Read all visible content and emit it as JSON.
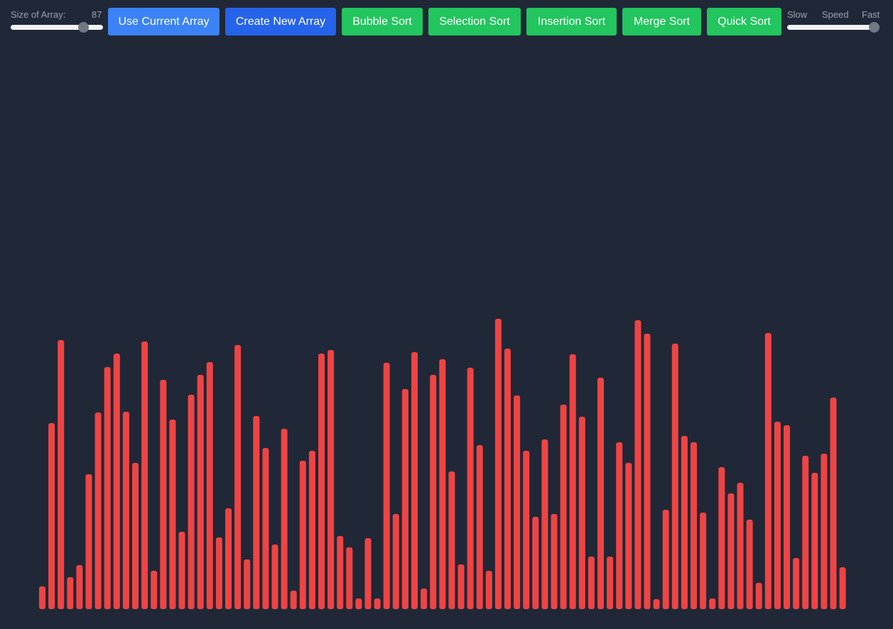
{
  "controls": {
    "size_label": "Size of Array:",
    "size_value": "87",
    "size_slider_fraction": 0.83,
    "speed_labels": [
      "Slow",
      "Speed",
      "Fast"
    ],
    "speed_slider_fraction": 1.0
  },
  "buttons": [
    {
      "id": "use-current-array",
      "label": "Use Current Array",
      "color": "#3b82f6"
    },
    {
      "id": "create-new-array",
      "label": "Create New Array",
      "color": "#2563eb"
    },
    {
      "id": "bubble-sort",
      "label": "Bubble Sort",
      "color": "#22c55e"
    },
    {
      "id": "selection-sort",
      "label": "Selection Sort",
      "color": "#22c55e"
    },
    {
      "id": "insertion-sort",
      "label": "Insertion Sort",
      "color": "#22c55e"
    },
    {
      "id": "merge-sort",
      "label": "Merge Sort",
      "color": "#22c55e"
    },
    {
      "id": "quick-sort",
      "label": "Quick Sort",
      "color": "#22c55e"
    }
  ],
  "colors": {
    "background": "#202837",
    "bar": "#ef4444"
  },
  "array_values": [
    28,
    258,
    375,
    41,
    58,
    186,
    273,
    337,
    356,
    274,
    202,
    373,
    50,
    319,
    263,
    105,
    298,
    326,
    344,
    97,
    138,
    368,
    66,
    268,
    223,
    87,
    250,
    22,
    205,
    219,
    356,
    361,
    99,
    83,
    11,
    96,
    11,
    343,
    130,
    306,
    358,
    25,
    326,
    348,
    190,
    59,
    336,
    227,
    50,
    405,
    363,
    297,
    219,
    126,
    235,
    130,
    284,
    355,
    267,
    70,
    322,
    70,
    231,
    202,
    403,
    384,
    10,
    136,
    370,
    240,
    231,
    132,
    11,
    196,
    159,
    174,
    122,
    33,
    385,
    260,
    255,
    68,
    212,
    188,
    215,
    294,
    55
  ]
}
